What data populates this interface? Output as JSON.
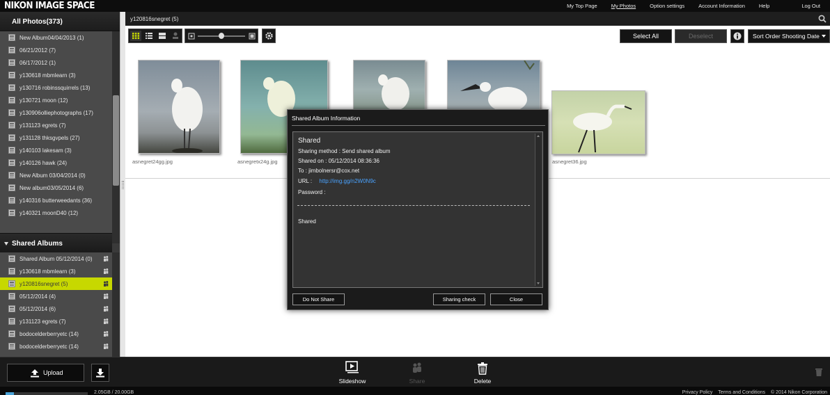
{
  "app": {
    "logo": "NIKON IMAGE SPACE"
  },
  "topnav": [
    {
      "label": "My Top Page",
      "active": false
    },
    {
      "label": "My Photos",
      "active": true
    },
    {
      "label": "Option settings",
      "active": false
    },
    {
      "label": "Account Information",
      "active": false
    },
    {
      "label": "Help",
      "active": false
    },
    {
      "label": "Log Out",
      "active": false
    }
  ],
  "sidebar": {
    "all_photos": "All Photos(373)",
    "albums": [
      "New Album04/04/2013 (1)",
      "06/21/2012 (7)",
      "06/17/2012 (1)",
      "y130618 mbmlearn (3)",
      "y130716 robinssquirrels (13)",
      "y130721 moon (12)",
      "y130906olliephotographs (17)",
      "y131123 egrets (7)",
      "y131128 thksgvpels (27)",
      "y140103 lakesam (3)",
      "y140126 hawk (24)",
      "New Album 03/04/2014 (0)",
      "New album03/05/2014 (6)",
      "y140316 butterweedants (36)",
      "y140321 moonD40 (12)"
    ],
    "shared_header": "Shared Albums",
    "shared_albums": [
      {
        "label": "Shared Album 05/12/2014 (0)",
        "selected": false
      },
      {
        "label": "y130618 mbmlearn (3)",
        "selected": false
      },
      {
        "label": "y120816snegret (5)",
        "selected": true
      },
      {
        "label": "05/12/2014 (4)",
        "selected": false
      },
      {
        "label": "05/12/2014 (6)",
        "selected": false
      },
      {
        "label": "y131123 egrets (7)",
        "selected": false
      },
      {
        "label": "bodocelderberryetc (14)",
        "selected": false
      },
      {
        "label": "bodocelderberryetc (14)",
        "selected": false
      }
    ]
  },
  "main": {
    "breadcrumb": "y120816snegret (5)",
    "toolbar": {
      "select_all": "Select All",
      "deselect": "Deselect",
      "sort": "Sort Order Shooting Date"
    },
    "photos": [
      {
        "caption": "asnegret24gg.jpg"
      },
      {
        "caption": "asnegretx24g.jpg"
      },
      {
        "caption": ""
      },
      {
        "caption": ""
      },
      {
        "caption": "asnegret36.jpg"
      }
    ]
  },
  "dialog": {
    "title": "Shared Album Information",
    "heading": "Shared",
    "method": "Sharing method : Send shared album",
    "shared_on": "Shared on : 05/12/2014 08:36:36",
    "to": "To : jimbolnersr@cox.net",
    "url_label": "URL :",
    "url": "http://img.gg/n2W0N9c",
    "password": "Password :",
    "status": "Shared",
    "buttons": {
      "do_not_share": "Do Not Share",
      "sharing_check": "Sharing check",
      "close": "Close"
    }
  },
  "bottom": {
    "upload": "Upload",
    "actions": {
      "slideshow": "Slideshow",
      "share": "Share",
      "delete": "Delete"
    },
    "storage_text": "2.05GB / 20.00GB",
    "storage_fraction": 0.1025,
    "footer_links": [
      "Privacy Policy",
      "Terms and Conditions",
      "© 2014 Nikon Corporation"
    ]
  },
  "colors": {
    "accent": "#c7d800",
    "link": "#4aa3ff"
  }
}
